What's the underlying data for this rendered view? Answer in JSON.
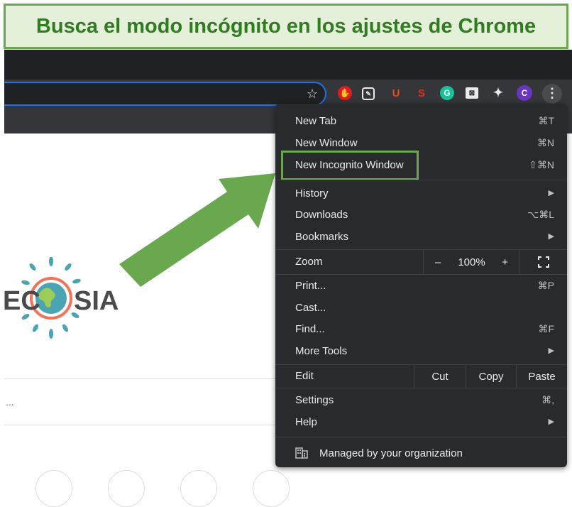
{
  "banner": {
    "title": "Busca el modo incógnito en los ajustes de Chrome"
  },
  "toolbar": {
    "extensions": [
      {
        "icon": "ublock-icon",
        "label": "",
        "color": "#e01b1b"
      },
      {
        "icon": "edit-icon",
        "label": "",
        "color": "#5f6368"
      },
      {
        "icon": "u-icon",
        "label": "U",
        "color": "#ea4c1d"
      },
      {
        "icon": "seo-icon",
        "label": "S",
        "color": "#d93025"
      },
      {
        "icon": "grammarly-icon",
        "label": "G",
        "color": "#15c39a"
      },
      {
        "icon": "ghostery-icon",
        "label": "",
        "color": "#202124"
      },
      {
        "icon": "puzzle-icon",
        "label": "",
        "color": "#e8eaed"
      },
      {
        "icon": "profile-avatar",
        "label": "C",
        "color": "#6b35c1"
      }
    ],
    "kebab": "⋮"
  },
  "menu": {
    "new_tab": {
      "label": "New Tab",
      "shortcut": "⌘T"
    },
    "new_window": {
      "label": "New Window",
      "shortcut": "⌘N"
    },
    "new_incognito": {
      "label": "New Incognito Window",
      "shortcut": "⇧⌘N"
    },
    "history": {
      "label": "History"
    },
    "downloads": {
      "label": "Downloads",
      "shortcut": "⌥⌘L"
    },
    "bookmarks": {
      "label": "Bookmarks"
    },
    "zoom": {
      "label": "Zoom",
      "minus": "–",
      "value": "100%",
      "plus": "+"
    },
    "print": {
      "label": "Print...",
      "shortcut": "⌘P"
    },
    "cast": {
      "label": "Cast..."
    },
    "find": {
      "label": "Find...",
      "shortcut": "⌘F"
    },
    "more_tools": {
      "label": "More Tools"
    },
    "edit": {
      "label": "Edit",
      "cut": "Cut",
      "copy": "Copy",
      "paste": "Paste"
    },
    "settings": {
      "label": "Settings",
      "shortcut": "⌘,"
    },
    "help": {
      "label": "Help"
    },
    "managed": {
      "label": "Managed by your organization"
    }
  },
  "page": {
    "logo_text_left": "EC",
    "logo_text_right": "SIA",
    "truncated": "..."
  }
}
